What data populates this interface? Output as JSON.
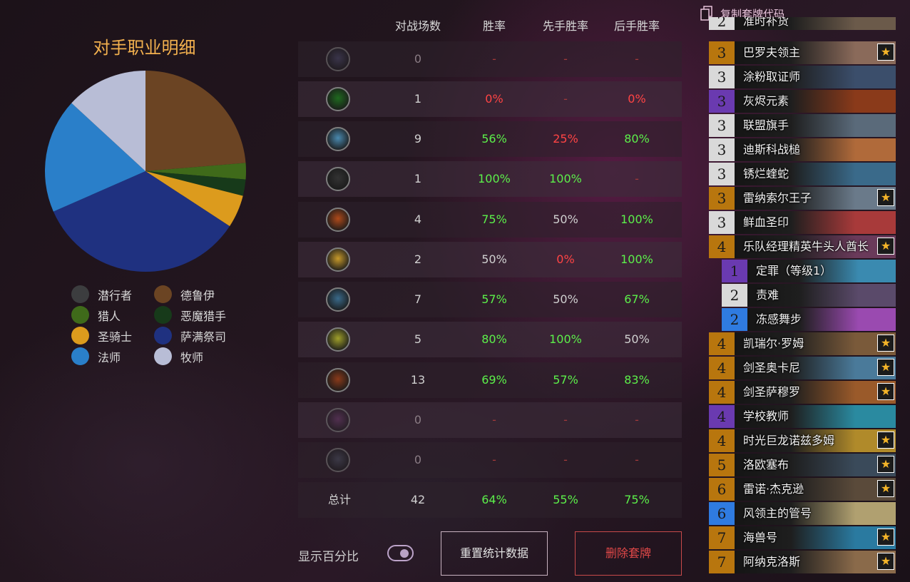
{
  "pie": {
    "title": "对手职业明细",
    "slices": [
      {
        "name": "潜行者",
        "value": 0,
        "color": "#3c3d3f"
      },
      {
        "name": "德鲁伊",
        "value": 9,
        "color": "#6b4423"
      },
      {
        "name": "猎人",
        "value": 1,
        "color": "#3f6a1a"
      },
      {
        "name": "恶魔猎手",
        "value": 1,
        "color": "#173a1a"
      },
      {
        "name": "圣骑士",
        "value": 2,
        "color": "#dc9b1d"
      },
      {
        "name": "萨满祭司",
        "value": 13,
        "color": "#1f3180"
      },
      {
        "name": "法师",
        "value": 7,
        "color": "#2a7fc9"
      },
      {
        "name": "牧师",
        "value": 5,
        "color": "#b8bdd6"
      }
    ]
  },
  "table": {
    "headers": {
      "games": "对战场数",
      "winrate": "胜率",
      "first": "先手胜率",
      "second": "后手胜率"
    },
    "rows": [
      {
        "icon": "rogue-class-icon",
        "games": "0",
        "wr": "-",
        "fwr": "-",
        "swr": "-"
      },
      {
        "icon": "demon-hunter-class-icon",
        "games": "1",
        "wr": "0%",
        "fwr": "-",
        "swr": "0%"
      },
      {
        "icon": "mage-class-icon",
        "games": "9",
        "wr": "56%",
        "fwr": "25%",
        "swr": "80%"
      },
      {
        "icon": "rogue-dagger-class-icon",
        "games": "1",
        "wr": "100%",
        "fwr": "100%",
        "swr": "-"
      },
      {
        "icon": "warrior-class-icon",
        "games": "4",
        "wr": "75%",
        "fwr": "50%",
        "swr": "100%"
      },
      {
        "icon": "paladin-class-icon",
        "games": "2",
        "wr": "50%",
        "fwr": "0%",
        "swr": "100%"
      },
      {
        "icon": "hunter-class-icon",
        "games": "7",
        "wr": "57%",
        "fwr": "50%",
        "swr": "67%"
      },
      {
        "icon": "priest-class-icon",
        "games": "5",
        "wr": "80%",
        "fwr": "100%",
        "swr": "50%"
      },
      {
        "icon": "shaman-class-icon",
        "games": "13",
        "wr": "69%",
        "fwr": "57%",
        "swr": "83%"
      },
      {
        "icon": "warlock-class-icon",
        "games": "0",
        "wr": "-",
        "fwr": "-",
        "swr": "-"
      },
      {
        "icon": "warrior-sword-class-icon",
        "games": "0",
        "wr": "-",
        "fwr": "-",
        "swr": "-"
      }
    ],
    "total": {
      "label": "总计",
      "games": "42",
      "wr": "64%",
      "fwr": "55%",
      "swr": "75%"
    }
  },
  "controls": {
    "toggle_label": "显示百分比",
    "reset_label": "重置统计数据",
    "delete_label": "删除套牌"
  },
  "deck": {
    "copy_label": "复制套牌代码",
    "cards": [
      {
        "cost": "2",
        "name": "准时补货",
        "rarity": "common",
        "legend": false,
        "art": "#6b5a4a"
      },
      {
        "cost": "3",
        "name": "巴罗夫领主",
        "rarity": "legendary",
        "legend": true,
        "art": "#8a6a5a"
      },
      {
        "cost": "3",
        "name": "涂粉取证师",
        "rarity": "common",
        "legend": false,
        "art": "#3b4e6b"
      },
      {
        "cost": "3",
        "name": "灰烬元素",
        "rarity": "epic",
        "legend": false,
        "art": "#8a3a1a"
      },
      {
        "cost": "3",
        "name": "联盟旗手",
        "rarity": "common",
        "legend": false,
        "art": "#5a6a7a"
      },
      {
        "cost": "3",
        "name": "迪斯科战槌",
        "rarity": "common",
        "legend": false,
        "art": "#b06a3a"
      },
      {
        "cost": "3",
        "name": "锈烂蝰蛇",
        "rarity": "common",
        "legend": false,
        "art": "#3a6a8a"
      },
      {
        "cost": "3",
        "name": "雷纳索尔王子",
        "rarity": "legendary",
        "legend": true,
        "art": "#6a7a8a"
      },
      {
        "cost": "3",
        "name": "鲜血圣印",
        "rarity": "common",
        "legend": false,
        "art": "#a83a3a"
      },
      {
        "cost": "4",
        "name": "乐队经理精英牛头人酋长",
        "rarity": "legendary",
        "legend": true,
        "art": "#6a3a5a"
      },
      {
        "cost": "1",
        "name": "定罪（等级1）",
        "rarity": "epic",
        "legend": false,
        "art": "#3a8ab0",
        "sub": true
      },
      {
        "cost": "2",
        "name": "责难",
        "rarity": "common",
        "legend": false,
        "art": "#5a4a6a",
        "sub": true
      },
      {
        "cost": "2",
        "name": "冻感舞步",
        "rarity": "rare",
        "legend": false,
        "art": "#9a4ab0",
        "sub": true
      },
      {
        "cost": "4",
        "name": "凯瑞尔·罗姆",
        "rarity": "legendary",
        "legend": true,
        "art": "#7a5a3a"
      },
      {
        "cost": "4",
        "name": "剑圣奥卡尼",
        "rarity": "legendary",
        "legend": true,
        "art": "#4a7a9a"
      },
      {
        "cost": "4",
        "name": "剑圣萨穆罗",
        "rarity": "legendary",
        "legend": true,
        "art": "#9a5a2a"
      },
      {
        "cost": "4",
        "name": "学校教师",
        "rarity": "epic",
        "legend": false,
        "art": "#2a8aa0"
      },
      {
        "cost": "4",
        "name": "时光巨龙诺兹多姆",
        "rarity": "legendary",
        "legend": true,
        "art": "#b08a2a"
      },
      {
        "cost": "5",
        "name": "洛欧塞布",
        "rarity": "legendary",
        "legend": true,
        "art": "#3a4a5a"
      },
      {
        "cost": "6",
        "name": "雷诺·杰克逊",
        "rarity": "legendary",
        "legend": true,
        "art": "#5a4a3a"
      },
      {
        "cost": "6",
        "name": "风领主的管号",
        "rarity": "rare",
        "legend": false,
        "art": "#b0a070"
      },
      {
        "cost": "7",
        "name": "海兽号",
        "rarity": "legendary",
        "legend": true,
        "art": "#2a7aa0"
      },
      {
        "cost": "7",
        "name": "阿纳克洛斯",
        "rarity": "legendary",
        "legend": true,
        "art": "#8a6a4a"
      }
    ]
  }
}
